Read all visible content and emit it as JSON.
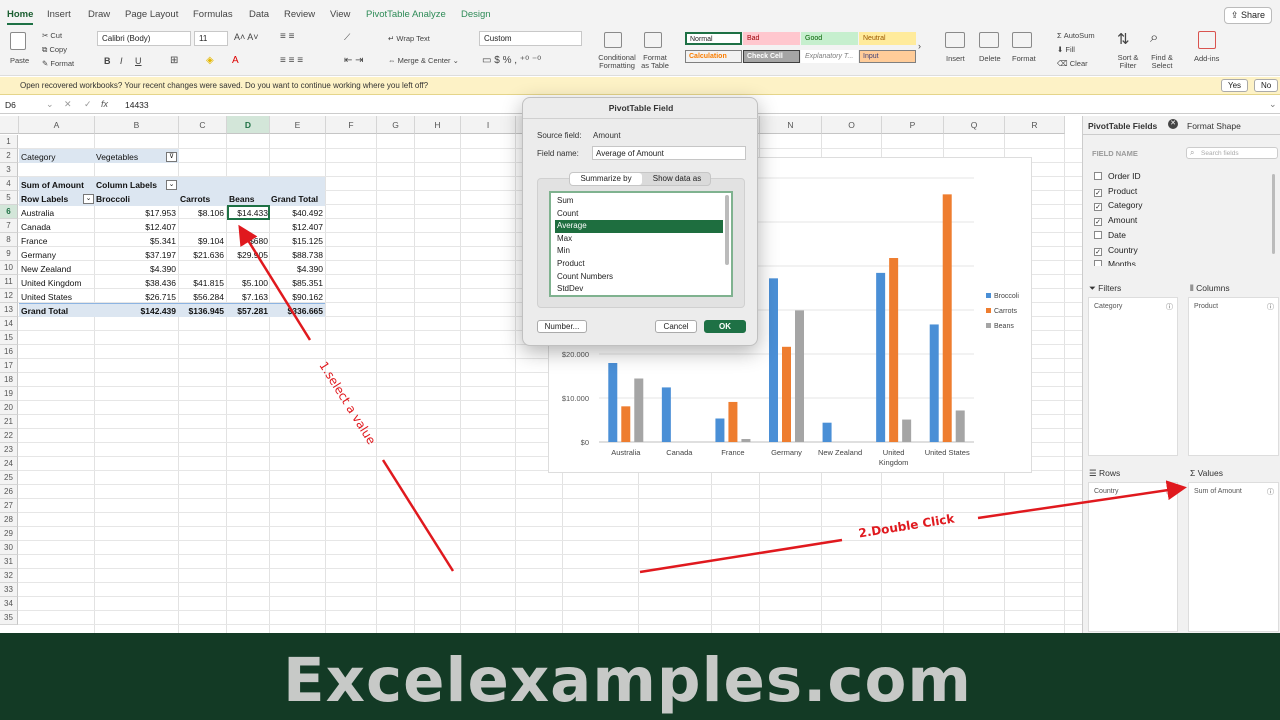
{
  "ribbon_tabs": [
    "Home",
    "Insert",
    "Draw",
    "Page Layout",
    "Formulas",
    "Data",
    "Review",
    "View",
    "PivotTable Analyze",
    "Design"
  ],
  "share_label": "Share",
  "ribbon": {
    "paste": "Paste",
    "cut": "Cut",
    "copy": "Copy",
    "format": "Format",
    "font_name": "Calibri (Body)",
    "font_size": "11",
    "wrap_text": "Wrap Text",
    "merge_center": "Merge & Center",
    "number_format": "Custom",
    "conditional_formatting": "Conditional Formatting",
    "format_as_table": "Format as Table",
    "styles": [
      {
        "label": "Normal",
        "bg": "#ffffff",
        "fg": "#222222",
        "border": "#1e7145"
      },
      {
        "label": "Bad",
        "bg": "#ffc7ce",
        "fg": "#9c0006",
        "border": "#ffc7ce"
      },
      {
        "label": "Good",
        "bg": "#c6efce",
        "fg": "#006100",
        "border": "#c6efce"
      },
      {
        "label": "Neutral",
        "bg": "#ffeb9c",
        "fg": "#9c5700",
        "border": "#ffeb9c"
      },
      {
        "label": "Calculation",
        "bg": "#f2f2f2",
        "fg": "#fa7d00",
        "border": "#7f7f7f"
      },
      {
        "label": "Check Cell",
        "bg": "#a5a5a5",
        "fg": "#ffffff",
        "border": "#3f3f3f"
      },
      {
        "label": "Explanatory T...",
        "bg": "#ffffff",
        "fg": "#7f7f7f",
        "border": "#ffffff"
      },
      {
        "label": "Input",
        "bg": "#ffcc99",
        "fg": "#3f3f76",
        "border": "#7f7f7f"
      }
    ],
    "insert": "Insert",
    "delete": "Delete",
    "format_cells": "Format",
    "autosum": "AutoSum",
    "fill": "Fill",
    "clear": "Clear",
    "sort_filter": "Sort & Filter",
    "find_select": "Find & Select",
    "addins": "Add-ins"
  },
  "notice": {
    "message": "Open recovered workbooks?   Your recent changes were saved. Do you want to continue working where you left off?",
    "yes": "Yes",
    "no": "No"
  },
  "formula_bar": {
    "cell_ref": "D6",
    "fx": "fx",
    "value": "14433"
  },
  "columns": [
    "A",
    "B",
    "C",
    "D",
    "E",
    "F",
    "G",
    "H",
    "I",
    "J",
    "K",
    "L",
    "M",
    "N",
    "O",
    "P",
    "Q",
    "R"
  ],
  "rows": [
    "1",
    "2",
    "3",
    "4",
    "5",
    "6",
    "7",
    "8",
    "9",
    "10",
    "11",
    "12",
    "13",
    "14",
    "15",
    "16",
    "17",
    "18",
    "19",
    "20",
    "21",
    "22",
    "23",
    "24",
    "25",
    "26",
    "27",
    "28",
    "29",
    "30",
    "31",
    "32",
    "33",
    "34",
    "35"
  ],
  "pivot": {
    "filter_label": "Category",
    "filter_value": "Vegetables",
    "value_label": "Sum of Amount",
    "column_labels": "Column Labels",
    "row_labels": "Row Labels",
    "headers": [
      "Broccoli",
      "Carrots",
      "Beans",
      "Grand Total"
    ],
    "rows": [
      {
        "label": "Australia",
        "values": [
          "$17.953",
          "$8.106",
          "$14.433",
          "$40.492"
        ]
      },
      {
        "label": "Canada",
        "values": [
          "$12.407",
          "",
          "",
          "$12.407"
        ]
      },
      {
        "label": "France",
        "values": [
          "$5.341",
          "$9.104",
          "$680",
          "$15.125"
        ]
      },
      {
        "label": "Germany",
        "values": [
          "$37.197",
          "$21.636",
          "$29.905",
          "$88.738"
        ]
      },
      {
        "label": "New Zealand",
        "values": [
          "$4.390",
          "",
          "",
          "$4.390"
        ]
      },
      {
        "label": "United Kingdom",
        "values": [
          "$38.436",
          "$41.815",
          "$5.100",
          "$85.351"
        ]
      },
      {
        "label": "United States",
        "values": [
          "$26.715",
          "$56.284",
          "$7.163",
          "$90.162"
        ]
      }
    ],
    "total": {
      "label": "Grand Total",
      "values": [
        "$142.439",
        "$136.945",
        "$57.281",
        "$336.665"
      ]
    }
  },
  "dialog": {
    "title": "PivotTable Field",
    "source_label": "Source field:",
    "source_value": "Amount",
    "name_label": "Field name:",
    "name_value": "Average of Amount",
    "tab_summarize": "Summarize by",
    "tab_show": "Show data as",
    "options": [
      "Sum",
      "Count",
      "Average",
      "Max",
      "Min",
      "Product",
      "Count Numbers",
      "StdDev"
    ],
    "selected_index": 2,
    "number_btn": "Number...",
    "cancel_btn": "Cancel",
    "ok_btn": "OK"
  },
  "chart_data": {
    "type": "bar",
    "categories": [
      "Australia",
      "Canada",
      "France",
      "Germany",
      "New Zealand",
      "United Kingdom",
      "United States"
    ],
    "category_labels": [
      "Australia",
      "Canada",
      "France",
      "Germany",
      "New Zealand",
      "United\nKingdom",
      "United States"
    ],
    "series": [
      {
        "name": "Broccoli",
        "color": "#4a8fd6",
        "values": [
          17953,
          12407,
          5341,
          37197,
          4390,
          38436,
          26715
        ]
      },
      {
        "name": "Carrots",
        "color": "#ee7d2f",
        "values": [
          8106,
          null,
          9104,
          21636,
          null,
          41815,
          56284
        ]
      },
      {
        "name": "Beans",
        "color": "#a5a5a5",
        "values": [
          14433,
          null,
          680,
          29905,
          null,
          5100,
          7163
        ]
      }
    ],
    "y_ticks": [
      "$0",
      "$10.000",
      "$20.000"
    ],
    "y_tick_values": [
      0,
      10000,
      20000
    ],
    "ylim": [
      0,
      60000
    ],
    "legend_position": "right",
    "grid": true
  },
  "pane": {
    "title": "PivotTable Fields",
    "format_shape": "Format Shape",
    "field_name": "FIELD NAME",
    "search_placeholder": "Search fields",
    "fields": [
      {
        "label": "Order ID",
        "checked": false
      },
      {
        "label": "Product",
        "checked": true
      },
      {
        "label": "Category",
        "checked": true
      },
      {
        "label": "Amount",
        "checked": true
      },
      {
        "label": "Date",
        "checked": false
      },
      {
        "label": "Country",
        "checked": true
      },
      {
        "label": "Months",
        "checked": false
      }
    ],
    "filters": "Filters",
    "columns": "Columns",
    "rows": "Rows",
    "values": "Values",
    "filter_field": "Category",
    "column_field": "Product",
    "row_field": "Country",
    "value_field": "Sum of Amount"
  },
  "annotations": {
    "step1": "1.select a value",
    "step2": "2.Double Click"
  },
  "banner": "Excelexamples.com"
}
